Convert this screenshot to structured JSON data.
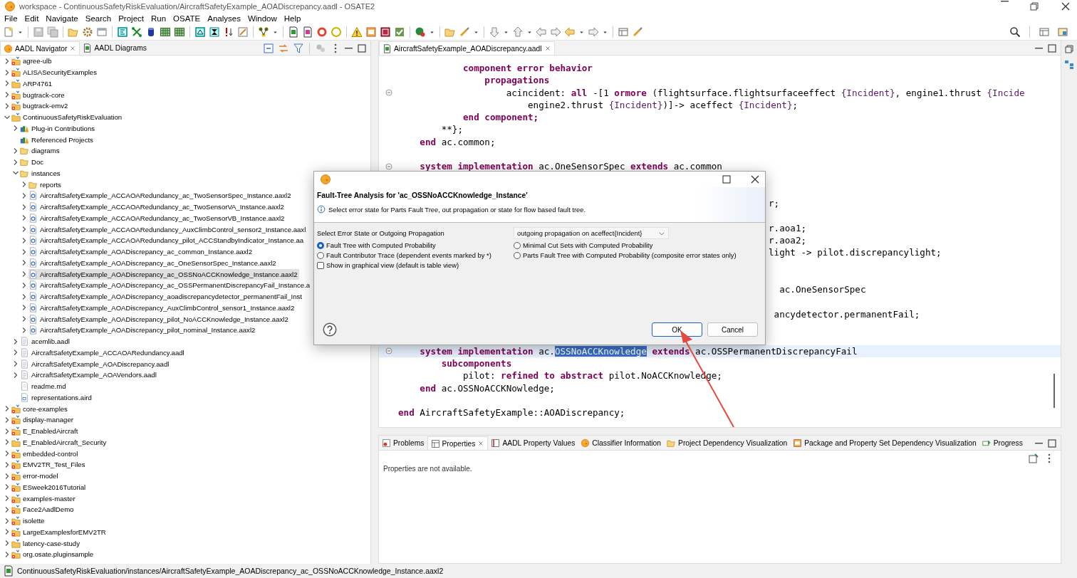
{
  "window": {
    "title": "workspace - ContinuousSafetyRiskEvaluation/AircraftSafetyExample_AOADiscrepancy.aadl - OSATE2"
  },
  "menu": [
    "File",
    "Edit",
    "Navigate",
    "Search",
    "Project",
    "Run",
    "OSATE",
    "Analyses",
    "Window",
    "Help"
  ],
  "navigator": {
    "tabs": [
      {
        "label": "AADL Navigator",
        "selected": true
      },
      {
        "label": "AADL Diagrams",
        "selected": false
      }
    ],
    "tree": [
      {
        "label": "agree-ulb",
        "kind": "project",
        "error": true,
        "expanded": false,
        "selected": false
      },
      {
        "label": "ALISASecurityExamples",
        "kind": "project",
        "error": true,
        "expanded": false,
        "selected": false
      },
      {
        "label": "ARP4761",
        "kind": "project",
        "error": false,
        "expanded": false,
        "selected": false
      },
      {
        "label": "bugtrack-core",
        "kind": "project",
        "error": true,
        "expanded": false,
        "selected": false
      },
      {
        "label": "bugtrack-emv2",
        "kind": "project",
        "error": true,
        "expanded": false,
        "selected": false
      },
      {
        "label": "ContinuousSafetyRiskEvaluation",
        "kind": "project",
        "error": false,
        "expanded": true,
        "selected": false,
        "children": [
          {
            "label": "Plug-in Contributions",
            "kind": "library",
            "expanded": false,
            "selected": false
          },
          {
            "label": "Referenced Projects",
            "kind": "library",
            "selected": false
          },
          {
            "label": "diagrams",
            "kind": "folder",
            "expanded": false,
            "selected": false
          },
          {
            "label": "Doc",
            "kind": "folder",
            "expanded": false,
            "selected": false
          },
          {
            "label": "instances",
            "kind": "folder",
            "expanded": true,
            "selected": false,
            "children": [
              {
                "label": "reports",
                "kind": "folder",
                "expanded": false,
                "selected": false
              },
              {
                "label": "AircraftSafetyExample_ACCAOARedundancy_ac_TwoSensorSpec_Instance.aaxl2",
                "kind": "instance",
                "expanded": false,
                "selected": false
              },
              {
                "label": "AircraftSafetyExample_ACCAOARedundancy_ac_TwoSensorVA_Instance.aaxl2",
                "kind": "instance",
                "expanded": false,
                "selected": false
              },
              {
                "label": "AircraftSafetyExample_ACCAOARedundancy_ac_TwoSensorVB_Instance.aaxl2",
                "kind": "instance",
                "expanded": false,
                "selected": false
              },
              {
                "label": "AircraftSafetyExample_ACCAOARedundancy_AuxClimbControl_sensor2_Instance.aaxl",
                "kind": "instance",
                "expanded": false,
                "selected": false
              },
              {
                "label": "AircraftSafetyExample_ACCAOARedundancy_pilot_ACCStandbyIndicator_Instance.aa",
                "kind": "instance",
                "expanded": false,
                "selected": false
              },
              {
                "label": "AircraftSafetyExample_AOADiscrepancy_ac_common_Instance.aaxl2",
                "kind": "instance",
                "expanded": false,
                "selected": false
              },
              {
                "label": "AircraftSafetyExample_AOADiscrepancy_ac_OneSensorSpec_Instance.aaxl2",
                "kind": "instance",
                "expanded": false,
                "selected": false
              },
              {
                "label": "AircraftSafetyExample_AOADiscrepancy_ac_OSSNoACCKnowledge_Instance.aaxl2",
                "kind": "instance",
                "expanded": false,
                "selected": true
              },
              {
                "label": "AircraftSafetyExample_AOADiscrepancy_ac_OSSPermanentDiscrepancyFail_Instance.a",
                "kind": "instance",
                "expanded": false,
                "selected": false
              },
              {
                "label": "AircraftSafetyExample_AOADiscrepancy_aoadiscrepancydetector_permanentFail_Inst",
                "kind": "instance",
                "expanded": false,
                "selected": false
              },
              {
                "label": "AircraftSafetyExample_AOADiscrepancy_AuxClimbControl_sensor1_Instance.aaxl2",
                "kind": "instance",
                "expanded": false,
                "selected": false
              },
              {
                "label": "AircraftSafetyExample_AOADiscrepancy_pilot_NoACCKnowledge_Instance.aaxl2",
                "kind": "instance",
                "expanded": false,
                "selected": false
              },
              {
                "label": "AircraftSafetyExample_AOADiscrepancy_pilot_nominal_Instance.aaxl2",
                "kind": "instance",
                "expanded": false,
                "selected": false
              }
            ]
          },
          {
            "label": "acemlib.aadl",
            "kind": "aadl",
            "expanded": false,
            "selected": false
          },
          {
            "label": "AircraftSafetyExample_ACCAOARedundancy.aadl",
            "kind": "aadl",
            "expanded": false,
            "selected": false
          },
          {
            "label": "AircraftSafetyExample_AOADiscrepancy.aadl",
            "kind": "aadl",
            "expanded": false,
            "selected": false
          },
          {
            "label": "AircraftSafetyExample_AOAVendors.aadl",
            "kind": "aadl",
            "expanded": false,
            "selected": false
          },
          {
            "label": "readme.md",
            "kind": "text",
            "selected": false
          },
          {
            "label": "representations.aird",
            "kind": "diagram",
            "selected": false
          }
        ]
      },
      {
        "label": "core-examples",
        "kind": "project",
        "error": true,
        "expanded": false,
        "selected": false
      },
      {
        "label": "display-manager",
        "kind": "project",
        "error": true,
        "expanded": false,
        "selected": false
      },
      {
        "label": "E_EnabledAircraft",
        "kind": "project",
        "error": true,
        "expanded": false,
        "selected": false
      },
      {
        "label": "E_EnabledAircraft_Security",
        "kind": "project",
        "error": false,
        "expanded": false,
        "selected": false
      },
      {
        "label": "embedded-control",
        "kind": "project",
        "error": true,
        "expanded": false,
        "selected": false
      },
      {
        "label": "EMV2TR_Test_Files",
        "kind": "project",
        "error": true,
        "expanded": false,
        "selected": false
      },
      {
        "label": "error-model",
        "kind": "project",
        "error": true,
        "expanded": false,
        "selected": false
      },
      {
        "label": "ESweek2016Tutorial",
        "kind": "project",
        "error": true,
        "expanded": false,
        "selected": false
      },
      {
        "label": "examples-master",
        "kind": "project",
        "error": true,
        "expanded": false,
        "selected": false
      },
      {
        "label": "Face2AadlDemo",
        "kind": "project",
        "error": true,
        "expanded": false,
        "selected": false
      },
      {
        "label": "isolette",
        "kind": "project",
        "error": true,
        "expanded": false,
        "selected": false
      },
      {
        "label": "LargeExamplesforEMV2TR",
        "kind": "project",
        "error": true,
        "expanded": false,
        "selected": false
      },
      {
        "label": "latency-case-study",
        "kind": "project",
        "error": false,
        "expanded": false,
        "selected": false
      },
      {
        "label": "org.osate.pluginsample",
        "kind": "project",
        "error": true,
        "expanded": false,
        "selected": false
      }
    ]
  },
  "editor": {
    "tabs": [
      {
        "label": "AircraftSafetyExample_AOADiscrepancy.aadl",
        "selected": true
      }
    ],
    "lines": [
      {
        "kind": "code",
        "fold": false,
        "current": false,
        "segments": [
          {
            "text": "            component error behavior",
            "kind": "keyword"
          }
        ]
      },
      {
        "kind": "code",
        "fold": false,
        "current": false,
        "segments": [
          {
            "text": "                propagations",
            "kind": "keyword"
          }
        ]
      },
      {
        "kind": "code",
        "fold": true,
        "current": false,
        "segments": [
          {
            "text": "                    acincident: ",
            "kind": "plain"
          },
          {
            "text": "all",
            "kind": "keyword"
          },
          {
            "text": " -[1 ",
            "kind": "plain"
          },
          {
            "text": "ormore",
            "kind": "keyword"
          },
          {
            "text": " (flightsurface.flightsurfaceeffect ",
            "kind": "plain"
          },
          {
            "text": "{Incident}",
            "kind": "property"
          },
          {
            "text": ", engine1.thrust ",
            "kind": "plain"
          },
          {
            "text": "{Incide",
            "kind": "property"
          }
        ]
      },
      {
        "kind": "code",
        "fold": false,
        "current": false,
        "segments": [
          {
            "text": "                        engine2.thrust ",
            "kind": "plain"
          },
          {
            "text": "{Incident}",
            "kind": "property"
          },
          {
            "text": ")]-> aceffect ",
            "kind": "plain"
          },
          {
            "text": "{Incident}",
            "kind": "property"
          },
          {
            "text": ";",
            "kind": "plain"
          }
        ]
      },
      {
        "kind": "code",
        "fold": false,
        "current": false,
        "segments": [
          {
            "text": "            end component;",
            "kind": "keyword"
          }
        ]
      },
      {
        "kind": "code",
        "fold": false,
        "current": false,
        "segments": [
          {
            "text": "        **};",
            "kind": "plain"
          }
        ]
      },
      {
        "kind": "code",
        "fold": false,
        "current": false,
        "segments": [
          {
            "text": "    end",
            "kind": "keyword"
          },
          {
            "text": " ac.common;",
            "kind": "plain"
          }
        ]
      },
      {
        "kind": "blank",
        "fold": false,
        "current": false
      },
      {
        "kind": "code",
        "fold": true,
        "current": false,
        "segments": [
          {
            "text": "    system implementation",
            "kind": "keyword"
          },
          {
            "text": " ac.OneSensorSpec ",
            "kind": "plain"
          },
          {
            "text": "extends",
            "kind": "keyword"
          },
          {
            "text": " ac.common",
            "kind": "plain"
          }
        ]
      },
      {
        "kind": "blank",
        "fold": false,
        "current": false
      },
      {
        "kind": "blank",
        "fold": false,
        "current": false
      },
      {
        "kind": "partial",
        "fold": false,
        "current": false,
        "segments": [
          {
            "text": "r;",
            "kind": "plain"
          }
        ]
      },
      {
        "kind": "blank",
        "fold": false,
        "current": false
      },
      {
        "kind": "partial",
        "fold": false,
        "current": false,
        "segments": [
          {
            "text": "r.aoa1;",
            "kind": "plain"
          }
        ]
      },
      {
        "kind": "partial",
        "fold": false,
        "current": false,
        "segments": [
          {
            "text": "r.aoa2;",
            "kind": "plain"
          }
        ]
      },
      {
        "kind": "partial",
        "fold": false,
        "current": false,
        "segments": [
          {
            "text": "light -> pilot.discrepancylight;",
            "kind": "plain"
          }
        ]
      },
      {
        "kind": "blank",
        "fold": false,
        "current": false
      },
      {
        "kind": "blank",
        "fold": false,
        "current": false
      },
      {
        "kind": "partial",
        "fold": false,
        "current": false,
        "segments": [
          {
            "text": "  ac.OneSensorSpec",
            "kind": "plain"
          }
        ]
      },
      {
        "kind": "blank",
        "fold": false,
        "current": false
      },
      {
        "kind": "partial",
        "fold": false,
        "current": false,
        "segments": [
          {
            "text": " ancydetector.permanentFail;",
            "kind": "plain"
          }
        ]
      },
      {
        "kind": "blank",
        "fold": false,
        "current": false
      },
      {
        "kind": "blank",
        "fold": false,
        "current": false
      },
      {
        "kind": "code",
        "fold": true,
        "current": true,
        "segments": [
          {
            "text": "    system implementation",
            "kind": "keyword"
          },
          {
            "text": " ac.",
            "kind": "plain"
          },
          {
            "text": "OSSNoACCKnowledge",
            "kind": "selected"
          },
          {
            "text": " extends",
            "kind": "keyword"
          },
          {
            "text": " ac.OSSPermanentDiscrepancyFail",
            "kind": "plain"
          }
        ]
      },
      {
        "kind": "code",
        "fold": false,
        "current": false,
        "segments": [
          {
            "text": "        subcomponents",
            "kind": "keyword"
          }
        ]
      },
      {
        "kind": "code",
        "fold": false,
        "current": false,
        "segments": [
          {
            "text": "            pilot: ",
            "kind": "plain"
          },
          {
            "text": "refined to abstract",
            "kind": "keyword"
          },
          {
            "text": " pilot.NoACCKnowledge;",
            "kind": "plain"
          }
        ]
      },
      {
        "kind": "code",
        "fold": false,
        "current": false,
        "segments": [
          {
            "text": "    end",
            "kind": "keyword"
          },
          {
            "text": " ac.OSSNoACCKNowledge;",
            "kind": "plain"
          }
        ]
      },
      {
        "kind": "blank",
        "fold": false,
        "current": false
      },
      {
        "kind": "code",
        "fold": false,
        "current": false,
        "segments": [
          {
            "text": "end",
            "kind": "keyword"
          },
          {
            "text": " AircraftSafetyExample::AOADiscrepancy;",
            "kind": "plain"
          }
        ]
      }
    ]
  },
  "bottom_panel": {
    "tabs": [
      {
        "label": "Problems",
        "kind": "problems",
        "selected": false
      },
      {
        "label": "Properties",
        "kind": "properties",
        "selected": true
      },
      {
        "label": "AADL Property Values",
        "kind": "values",
        "selected": false
      },
      {
        "label": "Classifier Information",
        "kind": "classifier",
        "selected": false
      },
      {
        "label": "Project Dependency Visualization",
        "kind": "folder",
        "selected": false
      },
      {
        "label": "Package and Property Set Dependency Visualization",
        "kind": "grid",
        "selected": false
      },
      {
        "label": "Progress",
        "kind": "progress",
        "selected": false
      }
    ],
    "message": "Properties are not available."
  },
  "dialog": {
    "heading": "Fault-Tree Analysis for 'ac_OSSNoACCKnowledge_Instance'",
    "message": "Select error state for Parts Fault Tree, out propagation or state for flow based fault tree.",
    "field_label": "Select Error State or Outgoing Propagation",
    "dropdown": {
      "value": "outgoing propagation on aceffect{Incident}"
    },
    "options": [
      {
        "label": "Fault Tree with Computed Probability",
        "selected": true
      },
      {
        "label": "Minimal Cut Sets with Computed Probability",
        "selected": false
      },
      {
        "label": "Fault Contributor Trace (dependent events marked by *)",
        "selected": false
      },
      {
        "label": "Parts Fault Tree with Computed Probability (composite error states only)",
        "selected": false
      }
    ],
    "checkbox": {
      "label": "Show in graphical view (default is table view)",
      "checked": false
    },
    "buttons": [
      {
        "label": "OK",
        "default": true
      },
      {
        "label": "Cancel",
        "default": false
      }
    ]
  },
  "status_bar": {
    "text": "ContinuousSafetyRiskEvaluation/instances/AircraftSafetyExample_AOADiscrepancy_ac_OSSNoACCKnowledge_Instance.aaxl2"
  }
}
